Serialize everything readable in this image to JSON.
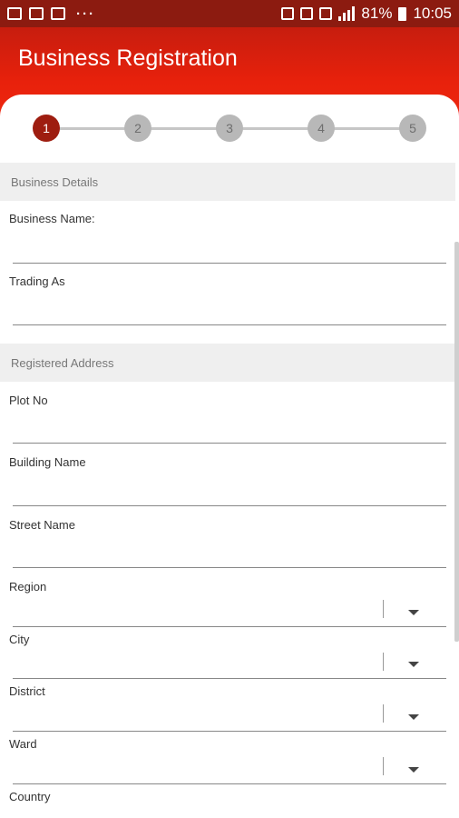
{
  "status": {
    "battery": "81%",
    "time": "10:05"
  },
  "app": {
    "title": "Business Registration"
  },
  "stepper": {
    "steps": [
      "1",
      "2",
      "3",
      "4",
      "5"
    ],
    "active": "1"
  },
  "sections": {
    "business_details": "Business Details",
    "registered_address": "Registered Address"
  },
  "fields": {
    "business_name": "Business Name:",
    "trading_as": "Trading As",
    "plot_no": "Plot No",
    "building_name": "Building Name",
    "street_name": "Street Name",
    "region": "Region",
    "city": "City",
    "district": "District",
    "ward": "Ward",
    "country": "Country"
  }
}
